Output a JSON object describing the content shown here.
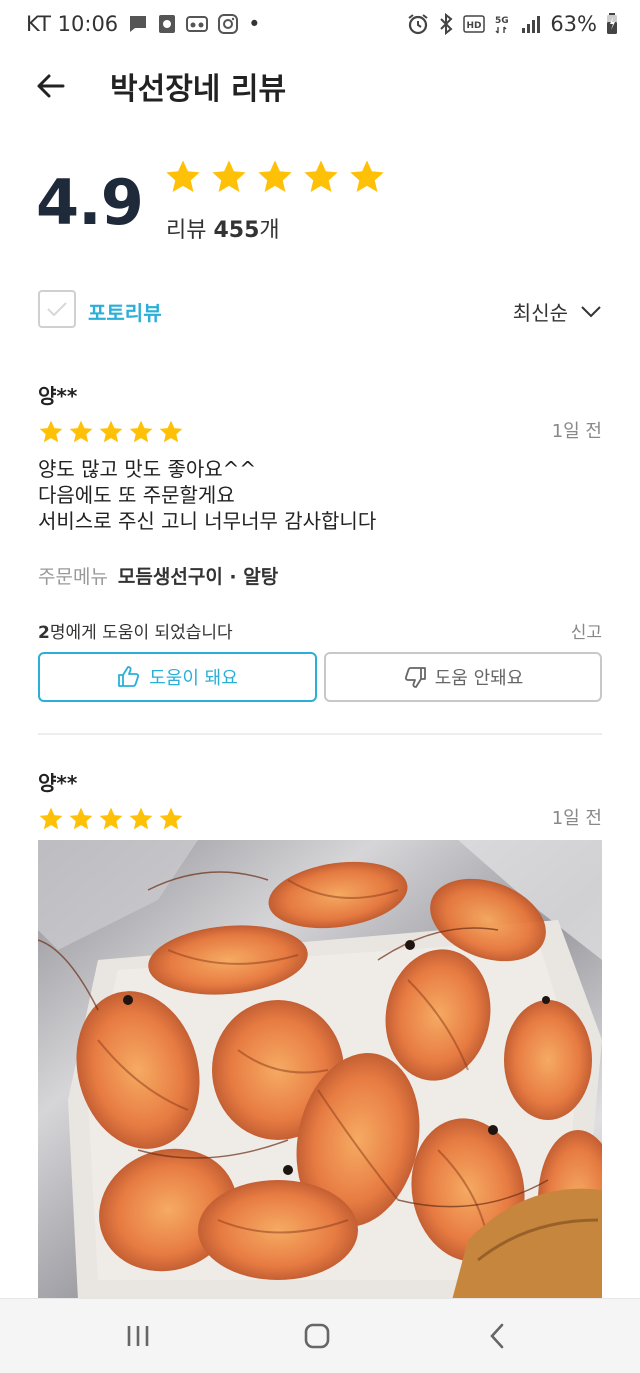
{
  "status_bar": {
    "carrier_time": "KT 10:06",
    "dot": "•",
    "battery": "63%",
    "network": "5G",
    "hd_label": "HD"
  },
  "header": {
    "title": "박선장네 리뷰"
  },
  "summary": {
    "rating": "4.9",
    "stars": 5,
    "count_prefix": "리뷰 ",
    "count_value": "455",
    "count_suffix": "개"
  },
  "filter": {
    "photo_review_label": "포토리뷰",
    "sort_label": "최신순"
  },
  "reviews": [
    {
      "reviewer": "양**",
      "stars": 5,
      "time": "1일 전",
      "text_lines": [
        "양도 많고 맛도  좋아요^^",
        "다음에도 또 주문할게요",
        "서비스로 주신 고니  너무너무 감사합니다"
      ],
      "order_label": "주문메뉴",
      "order_items": "모듬생선구이 · 알탕",
      "helpful_count": "2",
      "helpful_suffix": "명에게 도움이 되었습니다",
      "report_label": "신고",
      "helpful_yes_label": "도움이 돼요",
      "helpful_no_label": "도움 안돼요"
    },
    {
      "reviewer": "양**",
      "stars": 5,
      "time": "1일 전"
    }
  ],
  "colors": {
    "accent": "#2ab0d8",
    "star": "#ffc107",
    "rating_text": "#1e2a3a"
  }
}
